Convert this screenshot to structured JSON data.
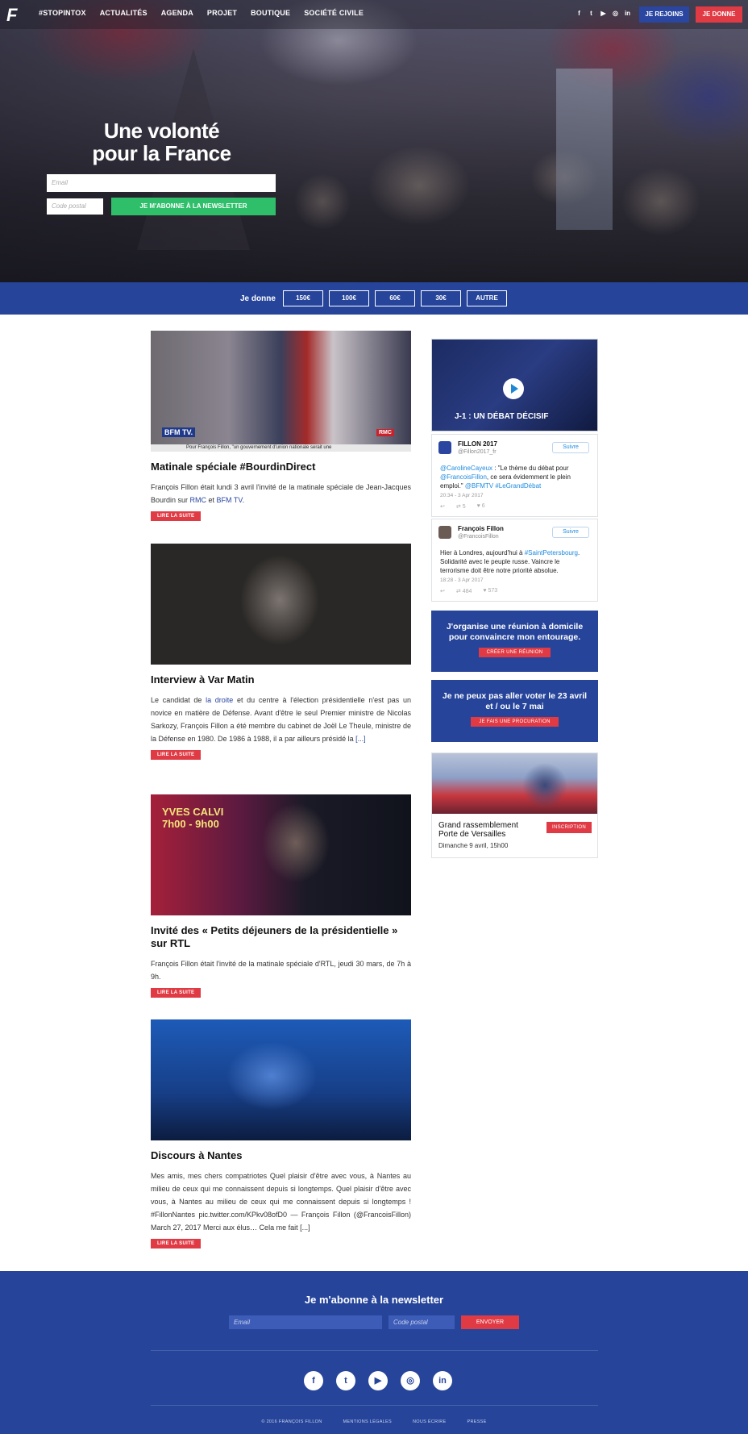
{
  "header": {
    "logo_text": "F",
    "nav": [
      "#STOPINTOX",
      "ACTUALITÉS",
      "AGENDA",
      "PROJET",
      "BOUTIQUE",
      "SOCIÉTÉ CIVILE"
    ],
    "social_icons": [
      "facebook-icon",
      "twitter-icon",
      "youtube-icon",
      "instagram-icon",
      "linkedin-icon"
    ],
    "join_label": "JE REJOINS",
    "donate_label": "JE DONNE"
  },
  "hero": {
    "title_line1": "Une volonté",
    "title_line2": "pour la France",
    "email_placeholder": "Email",
    "postal_placeholder": "Code postal",
    "subscribe_label": "JE M'ABONNE À LA NEWSLETTER"
  },
  "donate": {
    "label": "Je donne",
    "amounts": [
      "150€",
      "100€",
      "60€",
      "30€",
      "AUTRE"
    ]
  },
  "articles": [
    {
      "title": "Matinale spéciale #BourdinDirect",
      "text_parts": [
        "François Fillon était lundi 3 avril l'invité de la matinale spéciale de Jean-Jacques Bourdin sur ",
        "RMC",
        " et ",
        "BFM TV",
        "."
      ],
      "readmore": "LIRE LA SUITE",
      "image_caption": "Pour François Fillon, \"un gouvernement d'union nationale serait une"
    },
    {
      "title": "Interview à Var Matin",
      "text_parts": [
        "Le candidat de ",
        "la droite",
        " et du centre à l'élection présidentielle n'est pas un novice en matière de Défense. Avant d'être le seul Premier ministre de Nicolas Sarkozy, François Fillon a été membre du cabinet de Joël Le Theule, ministre de la Défense en 1980. De 1986 à 1988, il a par ailleurs présidé la ",
        "[...]"
      ],
      "readmore": "LIRE LA SUITE"
    },
    {
      "title": "Invité des « Petits déjeuners de la présidentielle » sur RTL",
      "text": "François Fillon était l'invité de la matinale spéciale d'RTL, jeudi 30 mars, de 7h à 9h.",
      "readmore": "LIRE LA SUITE",
      "image_caption_1": "YVES CALVI",
      "image_caption_2": "7h00 - 9h00"
    },
    {
      "title": "Discours à Nantes",
      "text": "Mes amis, mes chers compatriotes Quel plaisir d'être avec vous, à Nantes au milieu de ceux qui me connaissent depuis si longtemps. Quel plaisir d'être avec vous, à Nantes au milieu de ceux qui me connaissent depuis si longtemps ! #FillonNantes pic.twitter.com/KPkv08ofD0 — François Fillon (@FrancoisFillon) March 27, 2017 Merci aux élus… Cela me fait [...]",
      "readmore": "LIRE LA SUITE"
    }
  ],
  "sidebar": {
    "video_title": "J-1 : UN DÉBAT DÉCISIF",
    "tweets": [
      {
        "name": "FILLON 2017",
        "handle": "@Fillon2017_fr",
        "follow": "Suivre",
        "text_parts": [
          "@CarolineCayeux",
          " : \"Le thème du débat pour ",
          "@FrancoisFillon",
          ", ce sera évidemment le plein emploi.\" ",
          "@BFMTV #LeGrandDébat"
        ],
        "date": "20:34 - 3 Apr 2017",
        "retweets": "5",
        "likes": "6"
      },
      {
        "name": "François Fillon",
        "handle": "@FrancoisFillon",
        "follow": "Suivre",
        "text_parts": [
          "Hier à Londres, aujourd'hui à ",
          "#SaintPetersbourg",
          ". Solidarité avec le peuple russe. Vaincre le terrorisme doit être notre priorité absolue."
        ],
        "date": "18:28 - 3 Apr 2017",
        "retweets": "484",
        "likes": "573"
      }
    ],
    "promo1": {
      "title": "J'organise une réunion à domicile pour convaincre mon entourage.",
      "button": "CRÉER UNE RÉUNION"
    },
    "promo2": {
      "title": "Je ne peux pas aller voter le 23 avril et / ou le 7 mai",
      "button": "JE FAIS UNE PROCURATION"
    },
    "event": {
      "title": "Grand rassemblement Porte de Versailles",
      "date": "Dimanche 9 avril, 15h00",
      "button": "INSCRIPTION"
    }
  },
  "footer": {
    "title": "Je m'abonne à la newsletter",
    "email_placeholder": "Email",
    "postal_placeholder": "Code postal",
    "send_label": "ENVOYER",
    "socials": [
      "f",
      "t",
      "▶",
      "◎",
      "in"
    ],
    "links": [
      "© 2016 FRANÇOIS FILLON",
      "MENTIONS LÉGALES",
      "NOUS ÉCRIRE",
      "PRESSE"
    ]
  },
  "colors": {
    "brand_blue": "#26449a",
    "accent_red": "#e03a44",
    "subscribe_green": "#2fbf6a",
    "link_blue": "#1d8be0"
  }
}
